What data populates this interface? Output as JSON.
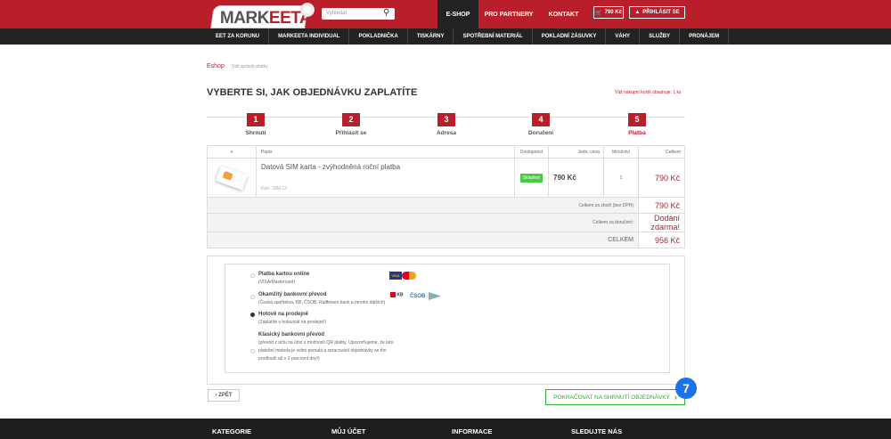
{
  "header": {
    "logo": "MARKEETA",
    "search_placeholder": "Vyhledat",
    "nav": [
      "E-SHOP",
      "PRO PARTNERY",
      "KONTAKT"
    ],
    "cart": "790 Kč",
    "login": "PŘIHLÁSIT SE"
  },
  "menu": [
    "EET ZA KORUNU",
    "MARKEETA INDIVIDUAL",
    "POKLADNIČKA",
    "TISKÁRNY",
    "SPOTŘEBNÍ MATERIÁL",
    "POKLADNÍ ZÁSUVKY",
    "VÁHY",
    "SLUŽBY",
    "PRONÁJEM"
  ],
  "breadcrumb": {
    "home": "Eshop",
    "current": "Váš způsob platby"
  },
  "title": "VYBERTE SI, JAK OBJEDNÁVKU ZAPLATÍTE",
  "cart_info": "Váš nákupní košík obsahuje: 1 ks",
  "steps": [
    {
      "n": "1",
      "label": "Shrnutí"
    },
    {
      "n": "2",
      "label": "Přihlásit se"
    },
    {
      "n": "3",
      "label": "Adresa"
    },
    {
      "n": "4",
      "label": "Doručení"
    },
    {
      "n": "5",
      "label": "Platba"
    }
  ],
  "table": {
    "headers": [
      "x",
      "Popis",
      "Dostupnost",
      "Jedn. cena",
      "Množství",
      "Celkem"
    ],
    "item": {
      "name": "Datová SIM karta - zvýhodněná roční platba",
      "code": "Kód : SIM 12",
      "availability": "Skladem",
      "unit_price": "790 Kč",
      "qty": "1",
      "total": "790 Kč"
    },
    "subtotal_label": "Celkem za zboží (bez DPH)",
    "subtotal": "790 Kč",
    "delivery_label": "Celkem za doručení:",
    "delivery": "Dodání zdarma!",
    "total_label": "CELKEM",
    "total": "956 Kč"
  },
  "payment": [
    {
      "title": "Platba kartou online",
      "desc": "(VISA/Mastercard)",
      "selected": false
    },
    {
      "title": "Okamžitý bankovní převod",
      "desc": "(Česká spořitelna, KB, ČSOB, Raiffeisen bank a mnoho dalších)",
      "selected": false
    },
    {
      "title": "Hotově na prodejně",
      "desc": "(Zaplatíte v hotovosti na prodejně)",
      "selected": true
    },
    {
      "title": "Klasický bankovní převod",
      "desc": "(převod z účtu na účet s možností QR platby. Upozorňujeme, že tato platební metoda je velmi pomalá a zpracování objednávky se tím prodlouží až o 3 pracovní dny!)",
      "selected": false
    }
  ],
  "logos": {
    "visa": "VISA",
    "kb": "KB",
    "csob": "ČSOB"
  },
  "buttons": {
    "back": "ZPĚT",
    "continue": "POKRAČOVAT NA SHRNUTÍ OBJEDNÁVKY"
  },
  "badge": "7",
  "footer": [
    "KATEGORIE",
    "MŮJ ÚČET",
    "INFORMACE",
    "SLEDUJTE NÁS"
  ]
}
